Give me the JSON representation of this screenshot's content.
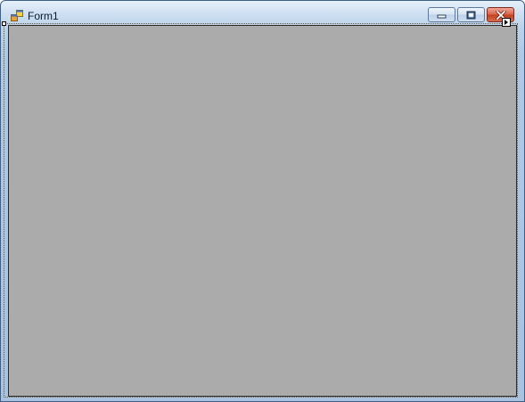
{
  "window": {
    "title": "Form1"
  },
  "caption_buttons": {
    "minimize_icon": "minimize-icon",
    "maximize_icon": "maximize-icon",
    "close_icon": "close-icon"
  },
  "colors": {
    "client_area": "#ababab",
    "close_button": "#c2401f",
    "frame": "#b0c9e3"
  }
}
